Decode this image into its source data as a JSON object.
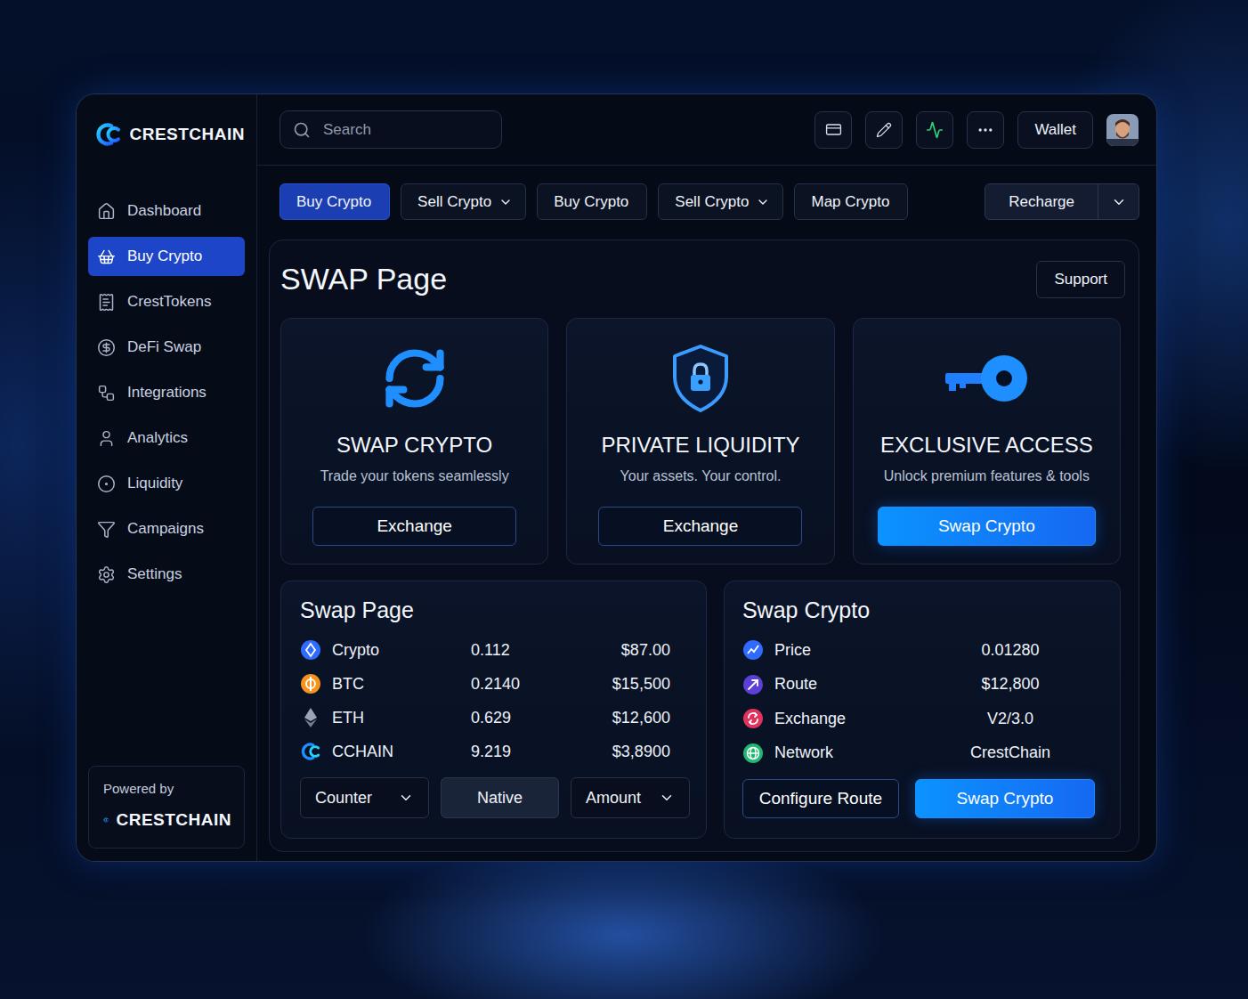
{
  "brand": {
    "name": "CRESTCHAIN"
  },
  "search": {
    "placeholder": "Search"
  },
  "topbar": {
    "wallet": "Wallet"
  },
  "sidebar": {
    "items": [
      {
        "label": "Dashboard",
        "selected": false
      },
      {
        "label": "Buy Crypto",
        "selected": true
      },
      {
        "label": "CrestTokens",
        "selected": false
      },
      {
        "label": "DeFi Swap",
        "selected": false
      },
      {
        "label": "Integrations",
        "selected": false
      },
      {
        "label": "Analytics",
        "selected": false
      },
      {
        "label": "Liquidity",
        "selected": false
      },
      {
        "label": "Campaigns",
        "selected": false
      },
      {
        "label": "Settings",
        "selected": false
      }
    ],
    "footer": {
      "caption": "Powered by",
      "brand": "CRESTCHAIN"
    }
  },
  "tabs": [
    {
      "label": "Buy Crypto",
      "selected": true,
      "kind": "button"
    },
    {
      "label": "Sell Crypto",
      "selected": false,
      "kind": "dropdown"
    },
    {
      "label": "Buy Crypto",
      "selected": false,
      "kind": "button"
    },
    {
      "label": "Sell Crypto",
      "selected": false,
      "kind": "dropdown"
    },
    {
      "label": "Map Crypto",
      "selected": false,
      "kind": "button"
    }
  ],
  "recharge": {
    "label": "Recharge"
  },
  "page": {
    "title": "SWAP Page",
    "support": "Support"
  },
  "features": [
    {
      "title": "SWAP CRYPTO",
      "subtitle": "Trade your tokens seamlessly",
      "button": "Exchange",
      "kind": "outline"
    },
    {
      "title": "PRIVATE LIQUIDITY",
      "subtitle": "Your assets. Your control.",
      "button": "Exchange",
      "kind": "outline"
    },
    {
      "title": "EXCLUSIVE ACCESS",
      "subtitle": "Unlock premium features & tools",
      "button": "Swap Crypto",
      "kind": "filled"
    }
  ],
  "holdings": {
    "title": "Swap Page",
    "rows": [
      {
        "name": "Crypto",
        "amount": "0.112",
        "value": "$87.00",
        "color": "#2f6bff"
      },
      {
        "name": "BTC",
        "amount": "0.2140",
        "value": "$15,500",
        "color": "#f7931a"
      },
      {
        "name": "ETH",
        "amount": "0.629",
        "value": "$12,600",
        "color": "#9aa3b8"
      },
      {
        "name": "CCHAIN",
        "amount": "9.219",
        "value": "$3,8900",
        "color": "#1e90ff"
      }
    ],
    "controls": [
      {
        "label": "Counter",
        "kind": "dropdown",
        "selected": false
      },
      {
        "label": "Native",
        "kind": "toggle",
        "selected": true
      },
      {
        "label": "Amount",
        "kind": "dropdown",
        "selected": false
      }
    ]
  },
  "details": {
    "title": "Swap Crypto",
    "rows": [
      {
        "label": "Price",
        "value": "0.01280",
        "color": "#2f6bff"
      },
      {
        "label": "Route",
        "value": "$12,800",
        "color": "#5b3fd6"
      },
      {
        "label": "Exchange",
        "value": "V2/3.0",
        "color": "#e0335e"
      },
      {
        "label": "Network",
        "value": "CrestChain",
        "color": "#1fb870"
      }
    ],
    "buttons": [
      {
        "label": "Configure Route",
        "kind": "outline"
      },
      {
        "label": "Swap Crypto",
        "kind": "filled"
      }
    ]
  }
}
